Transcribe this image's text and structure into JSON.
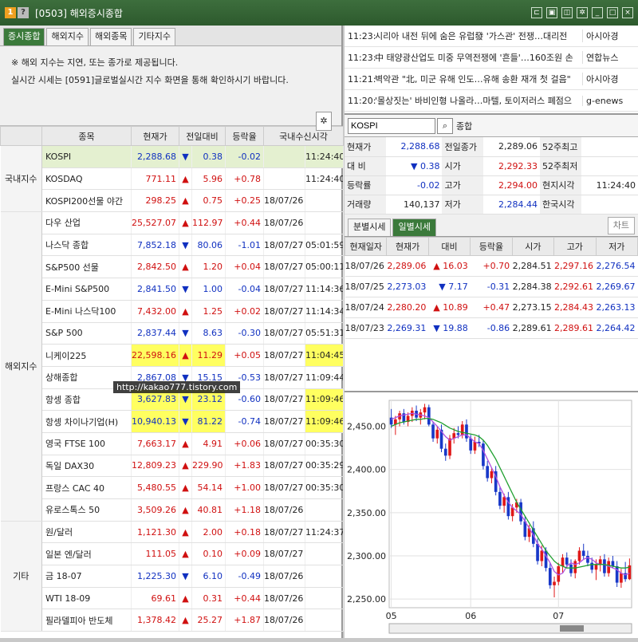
{
  "window": {
    "icon1": "1",
    "icon2": "?",
    "title": "[0503] 해외증시종합"
  },
  "tabs": [
    "증시종합",
    "해외지수",
    "해외종목",
    "기타지수"
  ],
  "notice": {
    "line1": "※ 해외 지수는 지연, 또는 종가로 제공됩니다.",
    "line2": "실시간 시세는  [0591]글로벌실시간 지수  화면을 통해 확인하시기 바랍니다."
  },
  "table": {
    "headers": [
      "종목",
      "현재가",
      "전일대비",
      "등락율",
      "국내수신시각"
    ],
    "groups": {
      "domestic": "국내지수",
      "overseas": "해외지수",
      "other": "기타"
    },
    "rows": [
      {
        "name": "KOSPI",
        "price": "2,288.68",
        "dir": "down",
        "change": "0.38",
        "rate": "-0.02",
        "time": "11:24:40",
        "date": "",
        "sel": true
      },
      {
        "name": "KOSDAQ",
        "price": "771.11",
        "dir": "up",
        "change": "5.96",
        "rate": "+0.78",
        "time": "11:24:40",
        "date": ""
      },
      {
        "name": "KOSPI200선물 야간",
        "price": "298.25",
        "dir": "up",
        "change": "0.75",
        "rate": "+0.25",
        "time": "",
        "date": "18/07/26"
      },
      {
        "name": "다우 산업",
        "price": "25,527.07",
        "dir": "up",
        "change": "112.97",
        "rate": "+0.44",
        "time": "",
        "date": "18/07/26"
      },
      {
        "name": "나스닥 종합",
        "price": "7,852.18",
        "dir": "down",
        "change": "80.06",
        "rate": "-1.01",
        "time": "05:01:59",
        "date": "18/07/27"
      },
      {
        "name": "S&P500 선물",
        "price": "2,842.50",
        "dir": "up",
        "change": "1.20",
        "rate": "+0.04",
        "time": "05:00:11",
        "date": "18/07/27"
      },
      {
        "name": "E-Mini S&P500",
        "price": "2,841.50",
        "dir": "down",
        "change": "1.00",
        "rate": "-0.04",
        "time": "11:14:36",
        "date": "18/07/27"
      },
      {
        "name": "E-Mini 나스닥100",
        "price": "7,432.00",
        "dir": "up",
        "change": "1.25",
        "rate": "+0.02",
        "time": "11:14:34",
        "date": "18/07/27"
      },
      {
        "name": "S&P 500",
        "price": "2,837.44",
        "dir": "down",
        "change": "8.63",
        "rate": "-0.30",
        "time": "05:51:31",
        "date": "18/07/27"
      },
      {
        "name": "니케이225",
        "price": "22,598.16",
        "dir": "up",
        "change": "11.29",
        "rate": "+0.05",
        "time": "11:04:45",
        "date": "18/07/27",
        "hl": true
      },
      {
        "name": "상해종합",
        "price": "2,867.08",
        "dir": "down",
        "change": "15.15",
        "rate": "-0.53",
        "time": "11:09:44",
        "date": "18/07/27"
      },
      {
        "name": "항셍 종합",
        "price": "3,627.83",
        "dir": "down",
        "change": "23.12",
        "rate": "-0.60",
        "time": "11:09:46",
        "date": "18/07/27",
        "hl": true
      },
      {
        "name": "항셍 차이나기업(H)",
        "price": "10,940.13",
        "dir": "down",
        "change": "81.22",
        "rate": "-0.74",
        "time": "11:09:46",
        "date": "18/07/27",
        "hl": true
      },
      {
        "name": "영국 FTSE 100",
        "price": "7,663.17",
        "dir": "up",
        "change": "4.91",
        "rate": "+0.06",
        "time": "00:35:30",
        "date": "18/07/27"
      },
      {
        "name": "독일 DAX30",
        "price": "12,809.23",
        "dir": "up",
        "change": "229.90",
        "rate": "+1.83",
        "time": "00:35:29",
        "date": "18/07/27"
      },
      {
        "name": "프랑스 CAC 40",
        "price": "5,480.55",
        "dir": "up",
        "change": "54.14",
        "rate": "+1.00",
        "time": "00:35:30",
        "date": "18/07/27"
      },
      {
        "name": "유로스톡스 50",
        "price": "3,509.26",
        "dir": "up",
        "change": "40.81",
        "rate": "+1.18",
        "time": "",
        "date": "18/07/26"
      },
      {
        "name": "원/달러",
        "price": "1,121.30",
        "dir": "up",
        "change": "2.00",
        "rate": "+0.18",
        "time": "11:24:37",
        "date": "18/07/27"
      },
      {
        "name": "일본 엔/달러",
        "price": "111.05",
        "dir": "up",
        "change": "0.10",
        "rate": "+0.09",
        "time": "",
        "date": "18/07/27"
      },
      {
        "name": "금 18-07",
        "price": "1,225.30",
        "dir": "down",
        "change": "6.10",
        "rate": "-0.49",
        "time": "",
        "date": "18/07/26"
      },
      {
        "name": "WTI 18-09",
        "price": "69.61",
        "dir": "up",
        "change": "0.31",
        "rate": "+0.44",
        "time": "",
        "date": "18/07/26"
      },
      {
        "name": "필라델피아 반도체",
        "price": "1,378.42",
        "dir": "up",
        "change": "25.27",
        "rate": "+1.87",
        "time": "",
        "date": "18/07/26"
      }
    ]
  },
  "watermark": "http://kakao777.tistory.com",
  "news": [
    {
      "time": "11:23:",
      "title": "시리아 내전 뒤에 숨은 유럽發 '가스관' 전쟁…대리전",
      "src": "아시아경"
    },
    {
      "time": "11:23:",
      "title": "中 태양광산업도 미중 무역전쟁에 '흔들'…160조원 손",
      "src": "연합뉴스"
    },
    {
      "time": "11:21:",
      "title": "벽악관 \"北, 미군 유해 인도…유해 송환 재개 첫 걸음\"",
      "src": "아시아경"
    },
    {
      "time": "11:20:",
      "title": "'몰상짓는' 바비인형 나올라…마텔, 토이저러스 폐점으",
      "src": "g-enews"
    }
  ],
  "search": {
    "value": "KOSPI",
    "label": "종합"
  },
  "quote": [
    [
      "현재가",
      "2,288.68",
      "전일종가",
      "2,289.06",
      "52주최고",
      ""
    ],
    [
      "대 비",
      "▼ 0.38",
      "시가",
      "2,292.33",
      "52주최저",
      ""
    ],
    [
      "등락률",
      "-0.02",
      "고가",
      "2,294.00",
      "현지시각",
      "11:24:40"
    ],
    [
      "거래량",
      "140,137",
      "저가",
      "2,284.44",
      "한국시각",
      ""
    ]
  ],
  "subtabs": [
    "분별시세",
    "일별시세"
  ],
  "chart_button": "차트",
  "daily": {
    "headers": [
      "현재일자",
      "현재가",
      "대비",
      "등락율",
      "시가",
      "고가",
      "저가"
    ],
    "rows": [
      {
        "date": "18/07/26",
        "price": "2,289.06",
        "dir": "up",
        "change": "16.03",
        "rate": "+0.70",
        "open": "2,284.51",
        "high": "2,297.16",
        "low": "2,276.54"
      },
      {
        "date": "18/07/25",
        "price": "2,273.03",
        "dir": "down",
        "change": "7.17",
        "rate": "-0.31",
        "open": "2,284.38",
        "high": "2,292.61",
        "low": "2,269.67"
      },
      {
        "date": "18/07/24",
        "price": "2,280.20",
        "dir": "up",
        "change": "10.89",
        "rate": "+0.47",
        "open": "2,273.15",
        "high": "2,284.43",
        "low": "2,263.13"
      },
      {
        "date": "18/07/23",
        "price": "2,269.31",
        "dir": "down",
        "change": "19.88",
        "rate": "-0.86",
        "open": "2,289.61",
        "high": "2,289.61",
        "low": "2,264.42"
      }
    ]
  },
  "chart_data": {
    "type": "candlestick",
    "y_ticks": [
      "2,450.00",
      "2,400.00",
      "2,350.00",
      "2,300.00",
      "2,250.00"
    ],
    "ylim": [
      2240,
      2480
    ],
    "x_ticks": [
      "05",
      "06",
      "07"
    ],
    "ohlc": [
      [
        2460,
        2470,
        2448,
        2452
      ],
      [
        2452,
        2462,
        2440,
        2458
      ],
      [
        2458,
        2468,
        2450,
        2465
      ],
      [
        2465,
        2470,
        2452,
        2455
      ],
      [
        2455,
        2466,
        2450,
        2462
      ],
      [
        2462,
        2472,
        2455,
        2468
      ],
      [
        2468,
        2474,
        2456,
        2460
      ],
      [
        2460,
        2470,
        2452,
        2466
      ],
      [
        2466,
        2476,
        2458,
        2472
      ],
      [
        2472,
        2475,
        2450,
        2452
      ],
      [
        2452,
        2455,
        2432,
        2436
      ],
      [
        2436,
        2450,
        2430,
        2446
      ],
      [
        2446,
        2452,
        2420,
        2424
      ],
      [
        2424,
        2430,
        2410,
        2416
      ],
      [
        2416,
        2440,
        2412,
        2436
      ],
      [
        2436,
        2448,
        2430,
        2442
      ],
      [
        2442,
        2450,
        2436,
        2440
      ],
      [
        2440,
        2456,
        2436,
        2452
      ],
      [
        2452,
        2458,
        2432,
        2436
      ],
      [
        2436,
        2440,
        2418,
        2422
      ],
      [
        2422,
        2438,
        2418,
        2432
      ],
      [
        2432,
        2440,
        2426,
        2430
      ],
      [
        2430,
        2434,
        2400,
        2404
      ],
      [
        2404,
        2410,
        2386,
        2390
      ],
      [
        2390,
        2402,
        2384,
        2398
      ],
      [
        2398,
        2404,
        2370,
        2374
      ],
      [
        2374,
        2380,
        2354,
        2358
      ],
      [
        2358,
        2372,
        2350,
        2368
      ],
      [
        2368,
        2374,
        2342,
        2346
      ],
      [
        2346,
        2360,
        2340,
        2356
      ],
      [
        2356,
        2366,
        2350,
        2362
      ],
      [
        2362,
        2366,
        2336,
        2340
      ],
      [
        2340,
        2346,
        2318,
        2322
      ],
      [
        2322,
        2336,
        2316,
        2332
      ],
      [
        2332,
        2340,
        2310,
        2314
      ],
      [
        2314,
        2320,
        2290,
        2294
      ],
      [
        2294,
        2312,
        2288,
        2306
      ],
      [
        2306,
        2310,
        2282,
        2286
      ],
      [
        2286,
        2292,
        2262,
        2266
      ],
      [
        2266,
        2276,
        2252,
        2270
      ],
      [
        2270,
        2292,
        2266,
        2288
      ],
      [
        2288,
        2302,
        2280,
        2298
      ],
      [
        2298,
        2304,
        2286,
        2290
      ],
      [
        2290,
        2296,
        2276,
        2280
      ],
      [
        2280,
        2296,
        2274,
        2294
      ],
      [
        2294,
        2310,
        2290,
        2306
      ],
      [
        2306,
        2314,
        2296,
        2300
      ],
      [
        2300,
        2306,
        2288,
        2292
      ],
      [
        2292,
        2298,
        2280,
        2284
      ],
      [
        2284,
        2296,
        2272,
        2290
      ],
      [
        2290,
        2300,
        2282,
        2296
      ],
      [
        2296,
        2302,
        2276,
        2280
      ],
      [
        2280,
        2298,
        2276,
        2294
      ],
      [
        2294,
        2300,
        2286,
        2288
      ],
      [
        2288,
        2294,
        2264,
        2269
      ],
      [
        2269,
        2285,
        2263,
        2280
      ],
      [
        2280,
        2293,
        2270,
        2273
      ],
      [
        2273,
        2297,
        2272,
        2289
      ]
    ],
    "ma_short": [
      2458,
      2460,
      2462,
      2463,
      2464,
      2465,
      2464,
      2463,
      2462,
      2460,
      2455,
      2450,
      2444,
      2438,
      2434,
      2436,
      2438,
      2440,
      2440,
      2436,
      2432,
      2430,
      2422,
      2412,
      2402,
      2392,
      2380,
      2370,
      2362,
      2356,
      2352,
      2348,
      2340,
      2332,
      2324,
      2314,
      2308,
      2300,
      2292,
      2282,
      2278,
      2280,
      2288,
      2292,
      2290,
      2292,
      2296,
      2298,
      2296,
      2292,
      2290,
      2290,
      2288,
      2286,
      2284,
      2280,
      2278,
      2280
    ],
    "ma_long": [
      2450,
      2452,
      2454,
      2455,
      2456,
      2457,
      2458,
      2458,
      2459,
      2459,
      2458,
      2456,
      2454,
      2451,
      2448,
      2446,
      2444,
      2443,
      2442,
      2441,
      2440,
      2438,
      2434,
      2428,
      2420,
      2412,
      2402,
      2392,
      2382,
      2372,
      2362,
      2354,
      2346,
      2338,
      2330,
      2322,
      2314,
      2306,
      2300,
      2294,
      2290,
      2288,
      2286,
      2286,
      2286,
      2287,
      2288,
      2289,
      2290,
      2290,
      2290,
      2290,
      2289,
      2288,
      2287,
      2286,
      2286,
      2287
    ]
  }
}
